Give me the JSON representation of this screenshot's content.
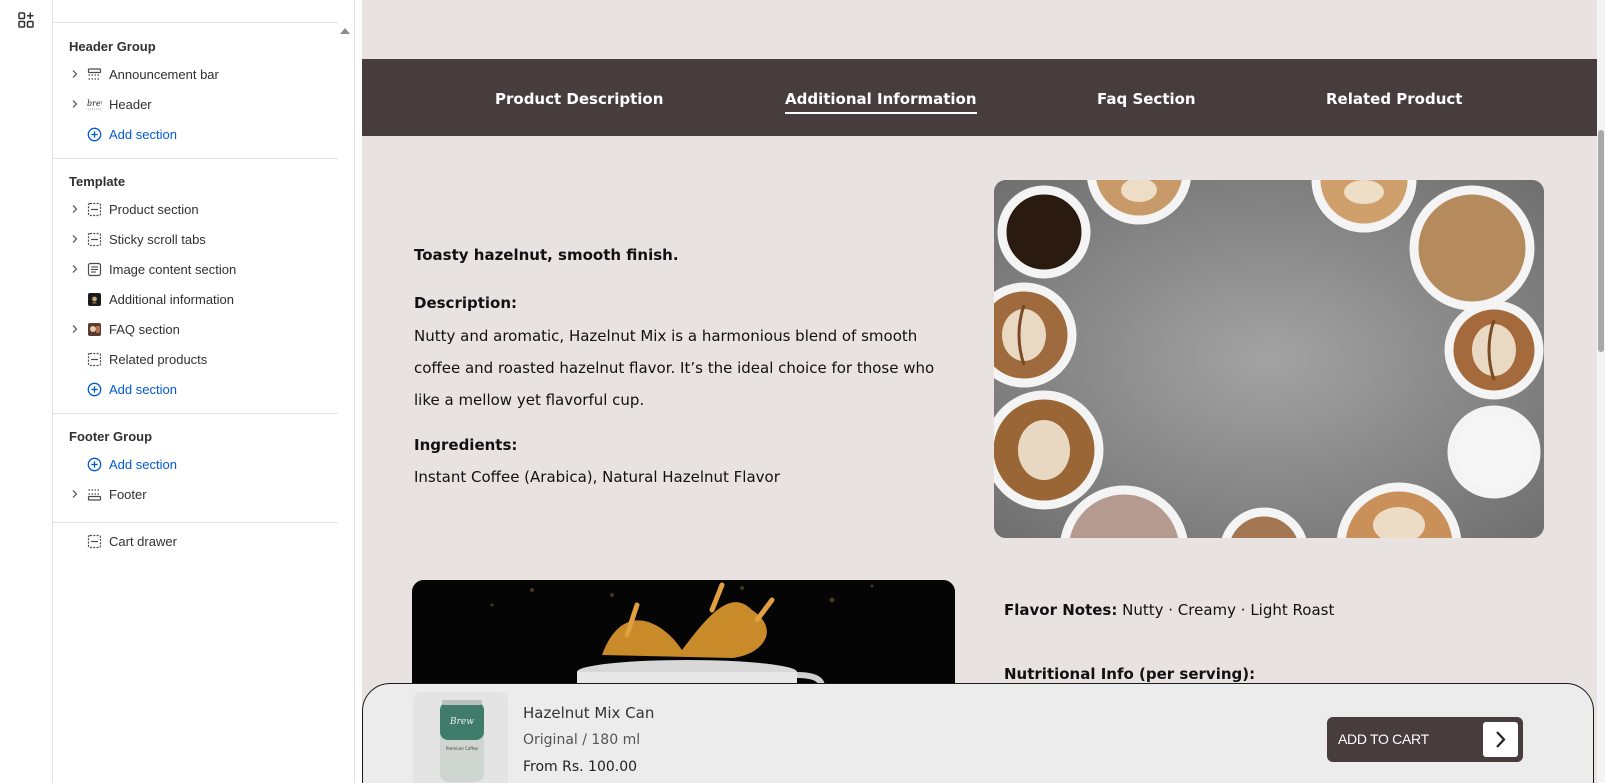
{
  "sidebar": {
    "header_group": {
      "title": "Header Group",
      "items": [
        {
          "label": "Announcement bar",
          "icon": "announcement-bar-icon",
          "expandable": true
        },
        {
          "label": "Header",
          "icon": "header-logo-icon",
          "expandable": true
        }
      ],
      "add_label": "Add section"
    },
    "template": {
      "title": "Template",
      "items": [
        {
          "label": "Product section",
          "icon": "section-icon",
          "expandable": true
        },
        {
          "label": "Sticky scroll tabs",
          "icon": "section-icon",
          "expandable": true
        },
        {
          "label": "Image content section",
          "icon": "text-block-icon",
          "expandable": true
        },
        {
          "label": "Additional information",
          "icon": "thumbnail-icon",
          "expandable": false
        },
        {
          "label": "FAQ section",
          "icon": "faq-thumbnail-icon",
          "expandable": true
        },
        {
          "label": "Related products",
          "icon": "section-icon",
          "expandable": false
        }
      ],
      "add_label": "Add section"
    },
    "footer_group": {
      "title": "Footer Group",
      "add_label": "Add section",
      "items": [
        {
          "label": "Footer",
          "icon": "footer-icon",
          "expandable": true
        }
      ]
    },
    "cart_drawer": {
      "label": "Cart drawer",
      "icon": "section-icon"
    }
  },
  "preview": {
    "tabs": [
      {
        "label": "Product Description",
        "active": false
      },
      {
        "label": "Additional Information",
        "active": true
      },
      {
        "label": "Faq Section",
        "active": false
      },
      {
        "label": "Related Product",
        "active": false
      }
    ],
    "info": {
      "tagline": "Toasty hazelnut, smooth finish.",
      "description_heading": "Description:",
      "description": "Nutty and aromatic, Hazelnut Mix is a harmonious blend of smooth coffee and roasted hazelnut flavor. It’s the ideal choice for those who like a mellow yet flavorful cup.",
      "ingredients_heading": "Ingredients:",
      "ingredients": "Instant Coffee (Arabica), Natural Hazelnut Flavor"
    },
    "flavor_label": "Flavor Notes:",
    "flavor_value": "Nutty · Creamy · Light Roast",
    "nutrition_heading": "Nutritional Info (per serving):"
  },
  "cart_bar": {
    "product_name": "Hazelnut Mix Can",
    "variant": "Original / 180 ml",
    "price": "From Rs. 100.00",
    "button_label": "ADD TO CART",
    "can_brand": "Brew",
    "can_text": "Premium Coffee"
  },
  "colors": {
    "accent_blue": "#005bd3",
    "tab_bar": "#473d3c",
    "page_bg": "#e8e3e0",
    "can_green": "#3f7d6a"
  }
}
